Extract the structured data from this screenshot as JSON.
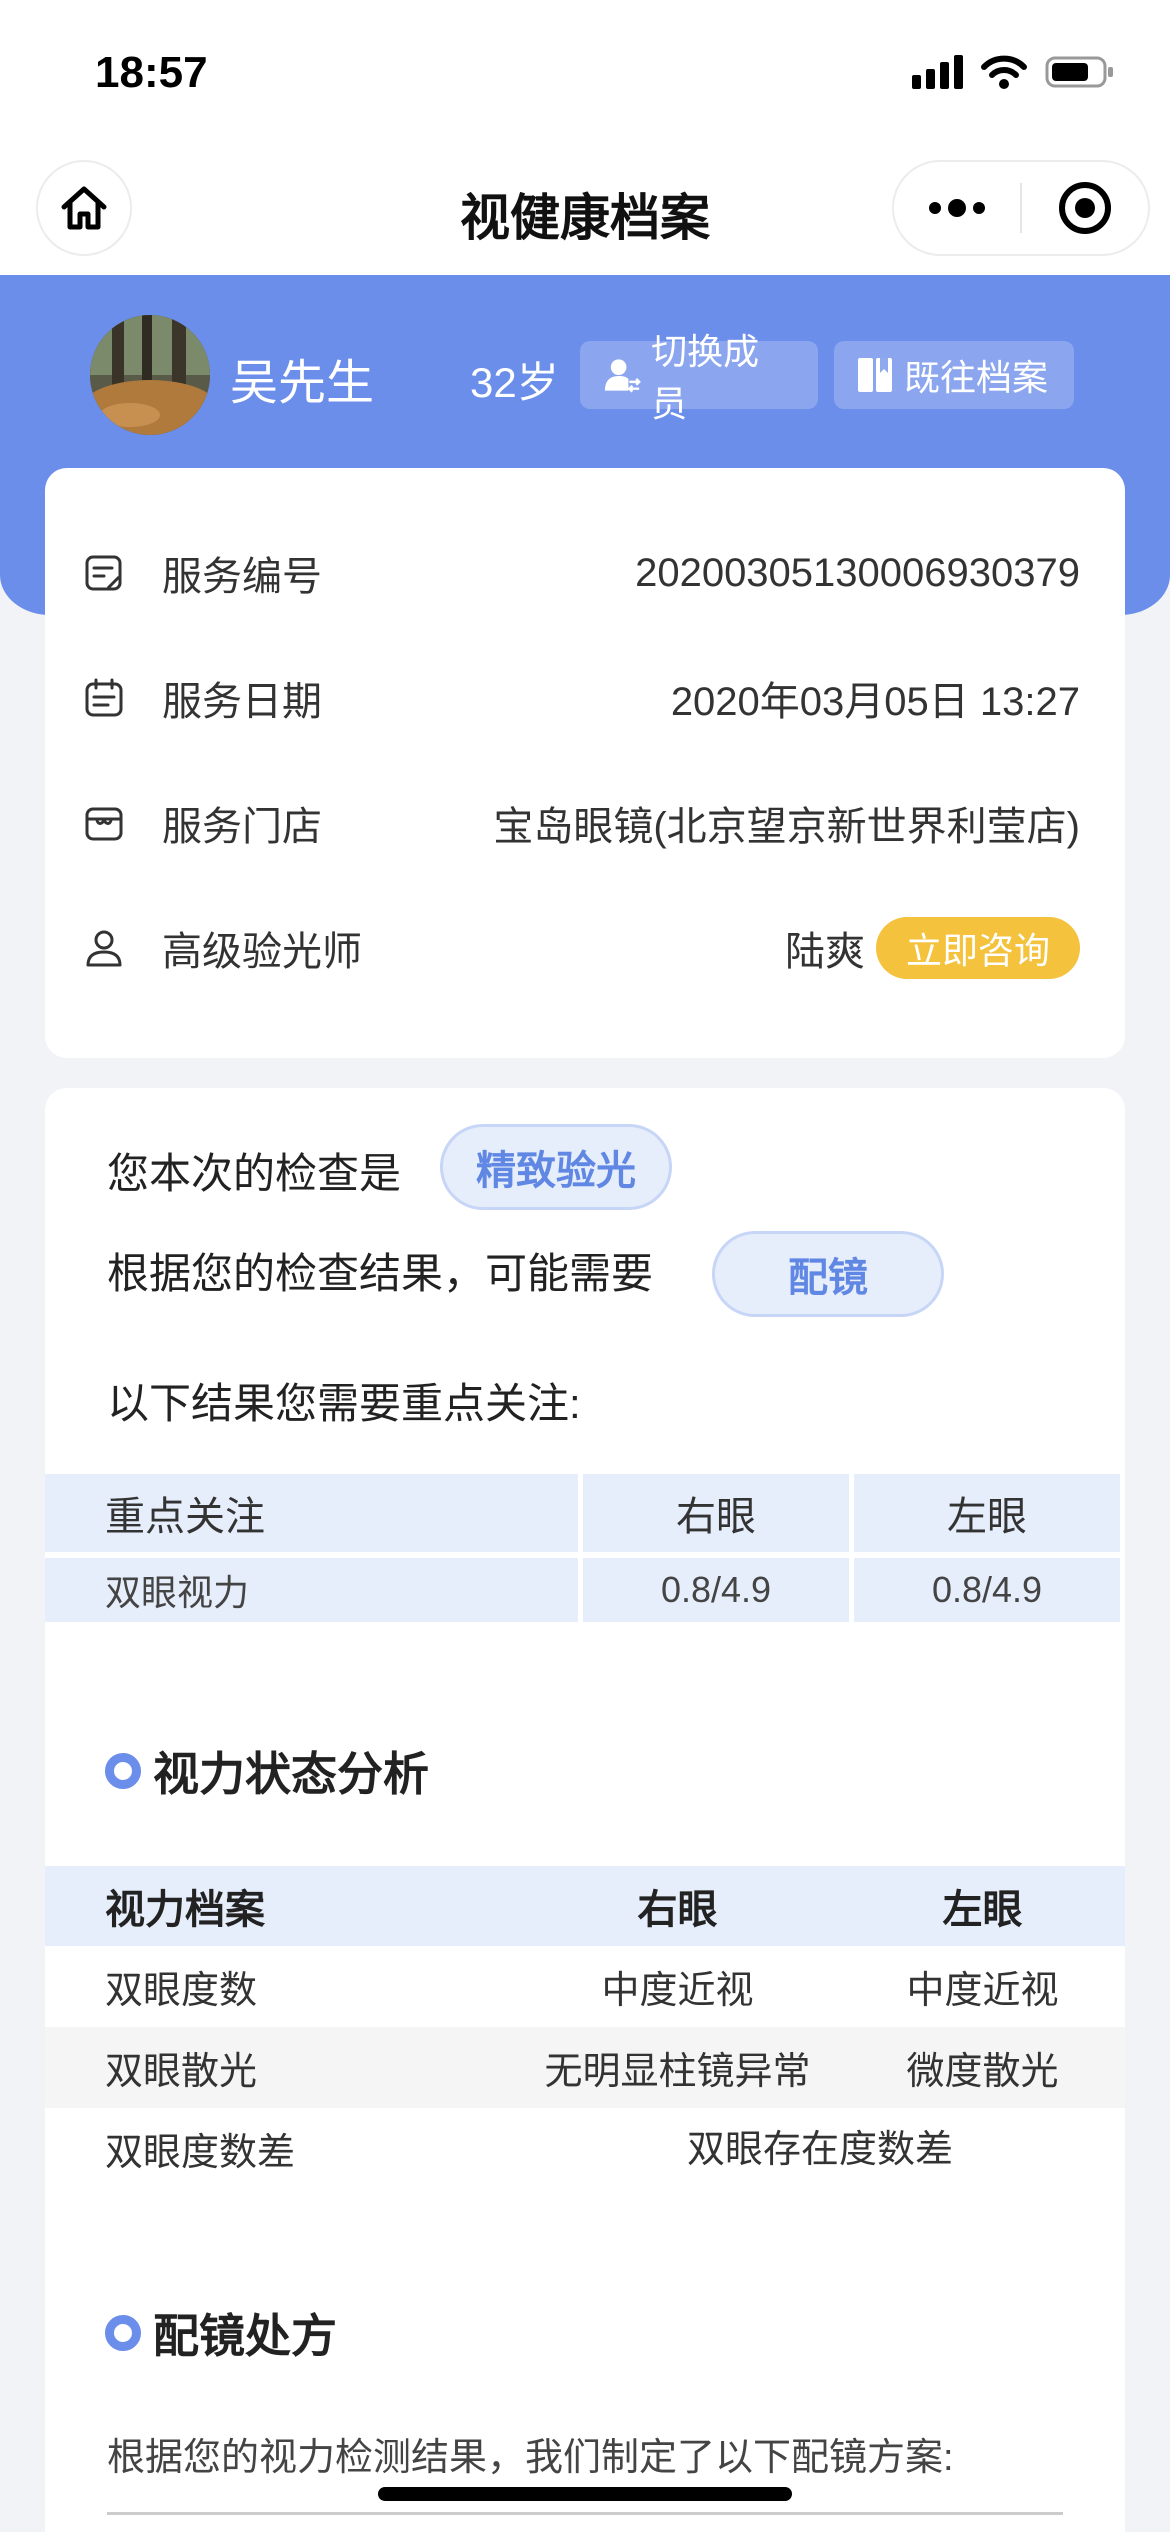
{
  "status_bar": {
    "time": "18:57"
  },
  "nav": {
    "title": "视健康档案"
  },
  "profile": {
    "name": "吴先生",
    "age": "32岁",
    "switch_label": "切换成员",
    "history_label": "既往档案"
  },
  "service_info": {
    "rows": [
      {
        "label": "服务编号",
        "value": "20200305130006930379",
        "icon": "memo-icon"
      },
      {
        "label": "服务日期",
        "value": "2020年03月05日 13:27",
        "icon": "calendar-icon"
      },
      {
        "label": "服务门店",
        "value": "宝岛眼镜(北京望京新世界利莹店)",
        "icon": "store-icon"
      },
      {
        "label": "高级验光师",
        "value": "陆爽",
        "icon": "person-icon"
      }
    ],
    "consult_label": "立即咨询",
    "consult_color": "#F4C23C"
  },
  "result": {
    "exam_prefix": "您本次的检查是",
    "exam_type": "精致验光",
    "need_prefix": "根据您的检查结果，可能需要",
    "need_item": "配镜",
    "focus_intro": "以下结果您需要重点关注:",
    "focus_table": {
      "headers": [
        "重点关注",
        "右眼",
        "左眼"
      ],
      "rows": [
        [
          "双眼视力",
          "0.8/4.9",
          "0.8/4.9"
        ]
      ]
    }
  },
  "vision_analysis": {
    "title": "视力状态分析",
    "headers": [
      "视力档案",
      "右眼",
      "左眼"
    ],
    "rows": [
      [
        "双眼度数",
        "中度近视",
        "中度近视"
      ],
      [
        "双眼散光",
        "无明显柱镜异常",
        "微度散光"
      ]
    ],
    "diff_label": "双眼度数差",
    "diff_value": "双眼存在度数差"
  },
  "prescription": {
    "title": "配镜处方",
    "intro": "根据您的视力检测结果，我们制定了以下配镜方案:"
  },
  "colors": {
    "accent": "#6B8EEA",
    "pill_bg": "#E6EDFB",
    "pill_text": "#5F87E3"
  }
}
